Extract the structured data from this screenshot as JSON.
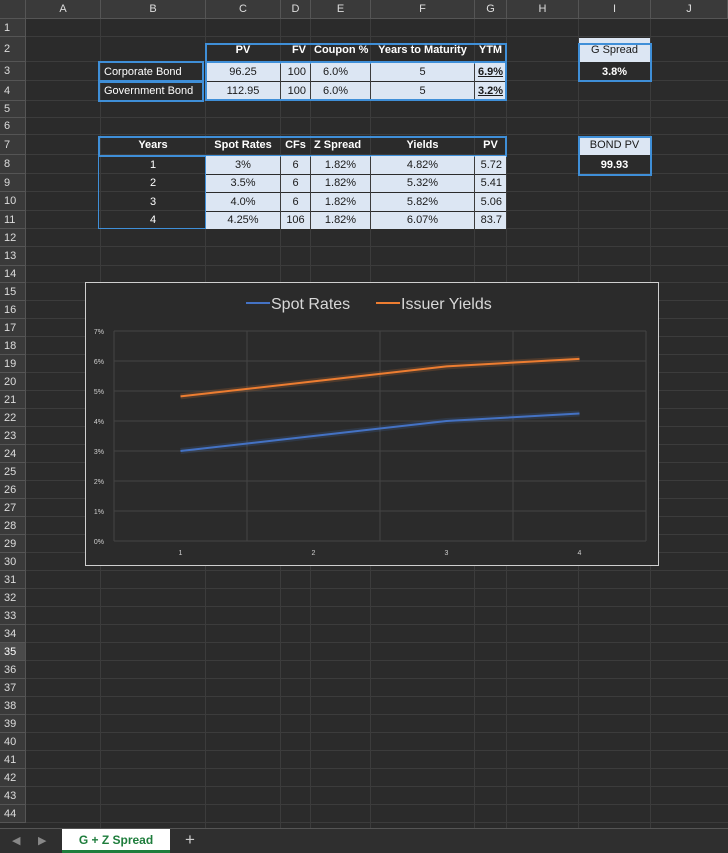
{
  "columns": [
    "A",
    "B",
    "C",
    "D",
    "E",
    "F",
    "G",
    "H",
    "I",
    "J"
  ],
  "rows": [
    "1",
    "2",
    "3",
    "4",
    "5",
    "6",
    "7",
    "8",
    "9",
    "10",
    "11",
    "12",
    "13",
    "14",
    "15",
    "16",
    "17",
    "18",
    "19",
    "20",
    "21",
    "22",
    "23",
    "24",
    "25",
    "26",
    "27",
    "28",
    "29",
    "30",
    "31",
    "32",
    "33",
    "34",
    "35",
    "36",
    "37",
    "38",
    "39",
    "40",
    "41",
    "42",
    "43",
    "44"
  ],
  "selected_row": "35",
  "bond_table": {
    "headers": {
      "pv": "PV",
      "fv": "FV",
      "coupon": "Coupon %",
      "years": "Years to Maturity",
      "ytm": "YTM"
    },
    "rows": [
      {
        "name": "Corporate Bond",
        "pv": "96.25",
        "fv": "100",
        "coupon": "6.0%",
        "years": "5",
        "ytm": "6.9%"
      },
      {
        "name": "Government Bond",
        "pv": "112.95",
        "fv": "100",
        "coupon": "6.0%",
        "years": "5",
        "ytm": "3.2%"
      }
    ]
  },
  "g_spread": {
    "label": "G Spread",
    "value": "3.8%"
  },
  "bond_pv": {
    "label": "BOND PV",
    "value": "99.93"
  },
  "spot_table": {
    "headers": {
      "years": "Years",
      "spot": "Spot Rates",
      "cfs": "CFs",
      "zspread": "Z Spread",
      "yields": "Yields",
      "pv": "PV"
    },
    "rows": [
      {
        "years": "1",
        "spot": "3%",
        "cfs": "6",
        "zspread": "1.82%",
        "yields": "4.82%",
        "pv": "5.72"
      },
      {
        "years": "2",
        "spot": "3.5%",
        "cfs": "6",
        "zspread": "1.82%",
        "yields": "5.32%",
        "pv": "5.41"
      },
      {
        "years": "3",
        "spot": "4.0%",
        "cfs": "6",
        "zspread": "1.82%",
        "yields": "5.82%",
        "pv": "5.06"
      },
      {
        "years": "4",
        "spot": "4.25%",
        "cfs": "106",
        "zspread": "1.82%",
        "yields": "6.07%",
        "pv": "83.7"
      }
    ]
  },
  "chart_data": {
    "type": "line",
    "x": [
      1,
      2,
      3,
      4
    ],
    "x_tick_labels": [
      "1",
      "2",
      "3",
      "4"
    ],
    "y_tick_labels": [
      "0%",
      "1%",
      "2%",
      "3%",
      "4%",
      "5%",
      "6%",
      "7%"
    ],
    "ylim": [
      0,
      0.07
    ],
    "grid": true,
    "legend_position": "top",
    "series": [
      {
        "name": "Spot Rates",
        "values": [
          0.03,
          0.035,
          0.04,
          0.0425
        ],
        "color": "#4472c4"
      },
      {
        "name": "Issuer Yields",
        "values": [
          0.0482,
          0.0532,
          0.0582,
          0.0607
        ],
        "color": "#ed7d31"
      }
    ]
  },
  "sheet_tab": {
    "label": "G + Z Spread",
    "add_label": "+",
    "prev": "◀",
    "next": "▶"
  }
}
